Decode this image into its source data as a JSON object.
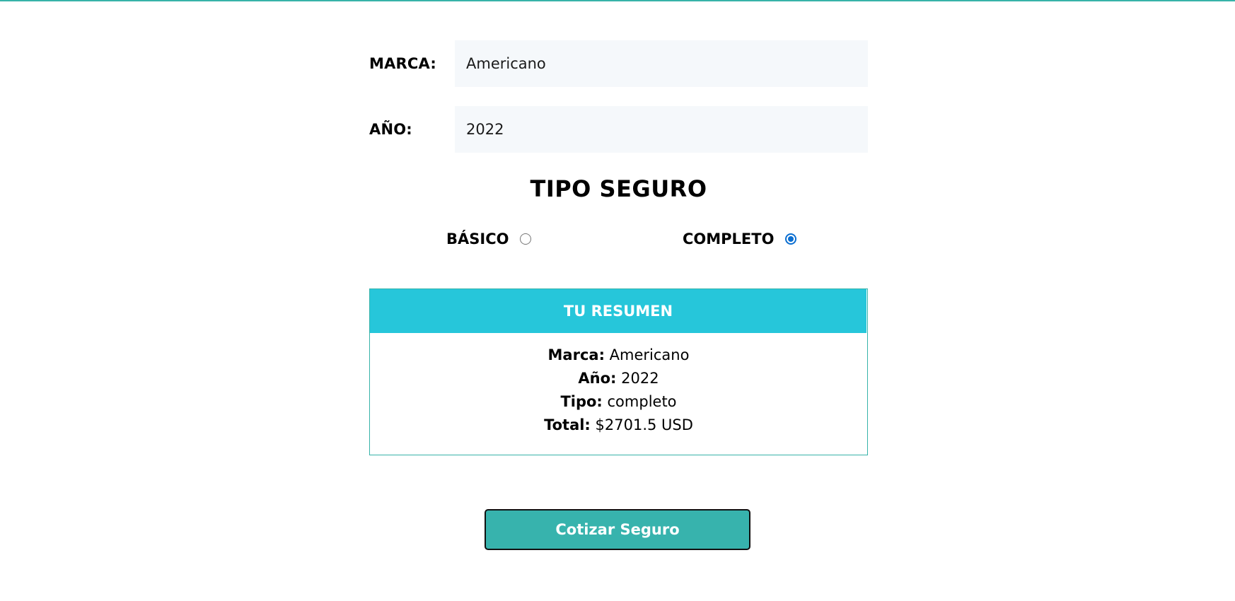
{
  "form": {
    "marca_label": "MARCA:",
    "marca_value": "Americano",
    "anio_label": "AÑO:",
    "anio_value": "2022"
  },
  "tipo_seguro": {
    "title": "TIPO SEGURO",
    "options": [
      {
        "label": "BÁSICO",
        "checked": false
      },
      {
        "label": "COMPLETO",
        "checked": true
      }
    ]
  },
  "summary": {
    "title": "TU RESUMEN",
    "rows": [
      {
        "key": "Marca:",
        "value": "Americano"
      },
      {
        "key": "Año:",
        "value": "2022"
      },
      {
        "key": "Tipo:",
        "value": "completo"
      },
      {
        "key": "Total:",
        "value": "$2701.5 USD"
      }
    ]
  },
  "actions": {
    "submit_label": "Cotizar Seguro"
  },
  "colors": {
    "accent": "#37b3a9",
    "summary_header": "#26c6da",
    "radio_checked": "#0a6ed1",
    "input_bg": "#f5f8fb"
  }
}
